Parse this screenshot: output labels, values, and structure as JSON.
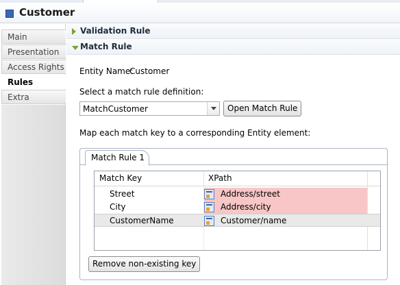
{
  "header": {
    "title": "Customer"
  },
  "sidebar": {
    "items": [
      {
        "label": "Main",
        "active": false
      },
      {
        "label": "Presentation",
        "active": false
      },
      {
        "label": "Access Rights",
        "active": false
      },
      {
        "label": "Rules",
        "active": true
      },
      {
        "label": "Extra",
        "active": false
      }
    ]
  },
  "sections": {
    "validation": {
      "title": "Validation Rule",
      "expanded": false
    },
    "match": {
      "title": "Match Rule",
      "expanded": true
    }
  },
  "match_rule": {
    "entity_name_label": "Entity Name:",
    "entity_name_value": "Customer",
    "select_label": "Select a match rule definition:",
    "selected_definition": "MatchCustomer",
    "open_button": "Open Match Rule",
    "map_label": "Map each match key to a corresponding Entity element:",
    "folder_tab": "Match Rule 1",
    "table": {
      "headers": {
        "key": "Match Key",
        "xpath": "XPath"
      },
      "rows": [
        {
          "key": "Street",
          "xpath": "Address/street",
          "invalid": true,
          "selected": false
        },
        {
          "key": "City",
          "xpath": "Address/city",
          "invalid": true,
          "selected": false
        },
        {
          "key": "CustomerName",
          "xpath": "Customer/name",
          "invalid": false,
          "selected": true
        }
      ]
    },
    "remove_button": "Remove non-existing key"
  },
  "colors": {
    "invalid_cell": "#f8c6c6",
    "twistie": "#7aa23a",
    "selected_row": "#e9e9e9"
  },
  "icons": {
    "twistie_collapsed": "triangle-right-icon",
    "twistie_expanded": "triangle-down-icon",
    "xpath": "xpath-element-icon",
    "entity": "entity-icon"
  }
}
